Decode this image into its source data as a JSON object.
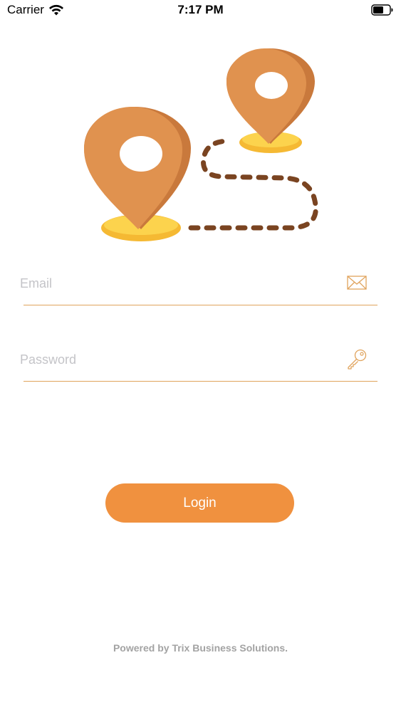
{
  "status_bar": {
    "carrier": "Carrier",
    "time": "7:17 PM"
  },
  "login_form": {
    "email_placeholder": "Email",
    "email_value": "",
    "password_placeholder": "Password",
    "password_value": "",
    "login_label": "Login"
  },
  "footer": {
    "text": "Powered by Trix Business Solutions."
  },
  "icons": {
    "wifi": "wifi-icon",
    "battery": "battery-icon",
    "email": "envelope-icon",
    "password": "key-icon",
    "hero": "map-pins-route-illustration"
  },
  "colors": {
    "accent": "#f0913f",
    "underline": "#e0a35c",
    "pin": "#e0924f",
    "pin_shadow": "#c9793c",
    "pin_base": "#fcd34d",
    "route": "#7a4421",
    "placeholder": "#c4c4c8",
    "footer": "#a3a3a3"
  }
}
